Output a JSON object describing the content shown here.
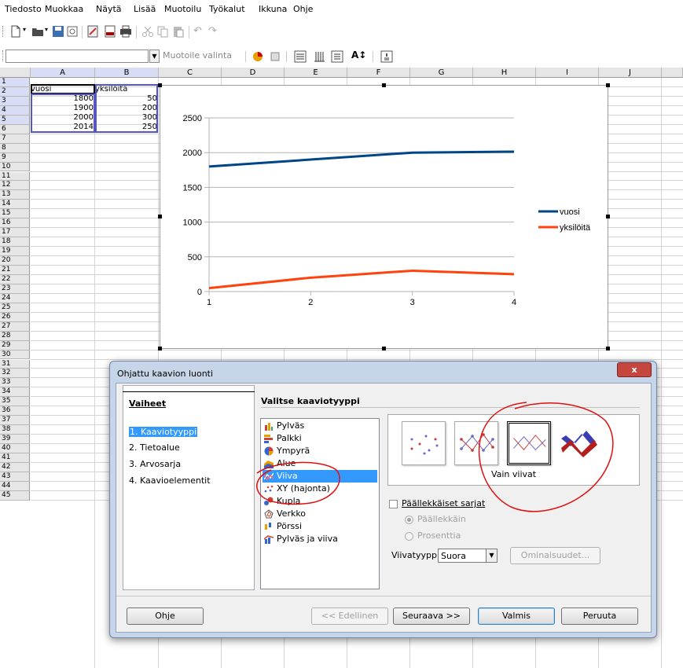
{
  "menu": [
    "Tiedosto",
    "Muokkaa",
    "Näytä",
    "Lisää",
    "Muotoilu",
    "Työkalut",
    "Ikkuna",
    "Ohje"
  ],
  "format_toolbar": {
    "style_placeholder": "Muotoile valinta"
  },
  "sheet": {
    "columns": [
      "A",
      "B",
      "C",
      "D",
      "E",
      "F",
      "G",
      "H",
      "I",
      "J"
    ],
    "rows": [
      "1",
      "2",
      "3",
      "4",
      "5",
      "6",
      "7",
      "8",
      "9",
      "10",
      "11",
      "12",
      "13",
      "14",
      "15",
      "16",
      "17",
      "18",
      "19",
      "20",
      "21",
      "22",
      "23",
      "24",
      "25",
      "26",
      "27",
      "28",
      "29",
      "30",
      "31",
      "32",
      "33",
      "34",
      "35",
      "36",
      "37",
      "38",
      "39",
      "40",
      "41",
      "42",
      "43",
      "44",
      "45"
    ],
    "cells": {
      "A1": "vuosi",
      "B1": "yksilöitä",
      "A2": "1800",
      "B2": "50",
      "A3": "1900",
      "B3": "200",
      "A4": "2000",
      "B4": "300",
      "A5": "2014",
      "B5": "250"
    }
  },
  "chart_data": {
    "type": "line",
    "x": [
      1,
      2,
      3,
      4
    ],
    "series": [
      {
        "name": "vuosi",
        "values": [
          1800,
          1900,
          2000,
          2014
        ],
        "color": "#004586"
      },
      {
        "name": "yksilöitä",
        "values": [
          50,
          200,
          300,
          250
        ],
        "color": "#ff420e"
      }
    ],
    "ylim": [
      0,
      2500
    ],
    "yticks": [
      0,
      500,
      1000,
      1500,
      2000,
      2500
    ],
    "xticks": [
      1,
      2,
      3,
      4
    ],
    "grid": true,
    "legend": "right"
  },
  "dialog": {
    "title": "Ohjattu kaavion luonti",
    "close_label": "x",
    "steps_heading": "Vaiheet",
    "steps": [
      "1. Kaaviotyyppi",
      "2. Tietoalue",
      "3. Arvosarja",
      "4. Kaavioelementit"
    ],
    "chart_type_heading": "Valitse kaaviotyyppi",
    "chart_types": [
      "Pylväs",
      "Palkki",
      "Ympyrä",
      "Alue",
      "Viiva",
      "XY (hajonta)",
      "Kupla",
      "Verkko",
      "Pörssi",
      "Pylväs ja viiva"
    ],
    "selected_type": "Viiva",
    "variant_caption": "Vain viivat",
    "stack_label": "Päällekkäiset sarjat",
    "stack_option_1": "Päällekkäin",
    "stack_option_2": "Prosenttia",
    "line_type_label": "Viivatyyppi",
    "line_type_value": "Suora",
    "properties_button": "Ominaisuudet...",
    "help_button": "Ohje",
    "back_button": "<< Edellinen",
    "next_button": "Seuraava >>",
    "finish_button": "Valmis",
    "cancel_button": "Peruuta"
  }
}
